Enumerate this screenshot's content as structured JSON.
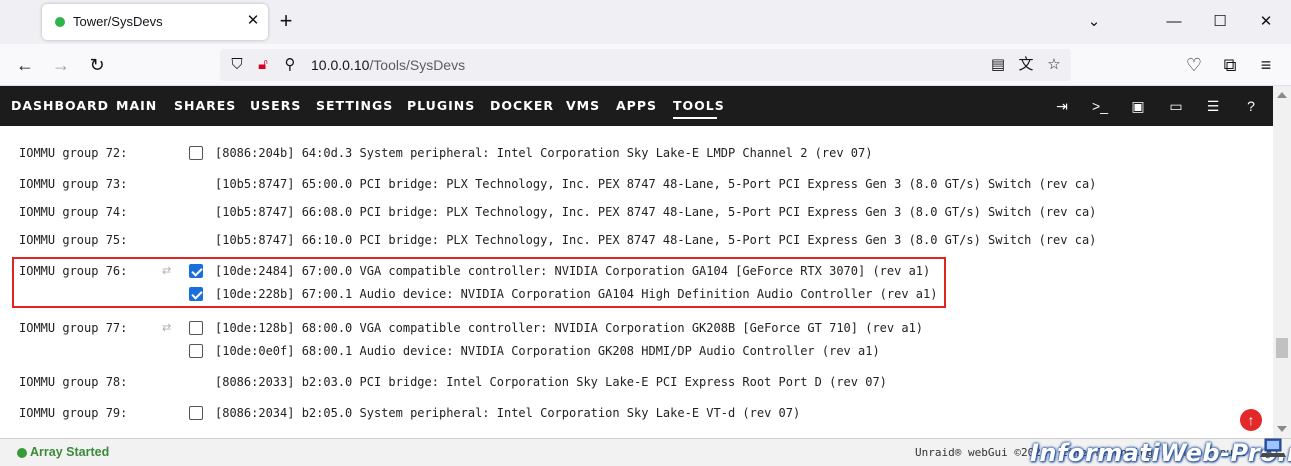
{
  "browser": {
    "tab_title": "Tower/SysDevs",
    "tab_status_color": "#2fb34a",
    "url_host": "10.0.0.10",
    "url_path": "/Tools/SysDevs"
  },
  "menu": {
    "items": [
      "DASHBOARD",
      "MAIN",
      "SHARES",
      "USERS",
      "SETTINGS",
      "PLUGINS",
      "DOCKER",
      "VMS",
      "APPS",
      "TOOLS"
    ],
    "active": "TOOLS",
    "icons": [
      "logout-icon",
      "terminal-icon",
      "feedback-icon",
      "monitor-icon",
      "log-icon",
      "help-icon"
    ]
  },
  "iommu": {
    "g72": {
      "label": "IOMMU group 72:",
      "devices": [
        {
          "text": "[8086:204b] 64:0d.3 System peripheral: Intel Corporation Sky Lake-E LMDP Channel 2 (rev 07)",
          "checked": false
        }
      ]
    },
    "g73": {
      "label": "IOMMU group 73:",
      "devices": [
        {
          "text": "[10b5:8747] 65:00.0 PCI bridge: PLX Technology, Inc. PEX 8747 48-Lane, 5-Port PCI Express Gen 3 (8.0 GT/s) Switch (rev ca)"
        }
      ]
    },
    "g74": {
      "label": "IOMMU group 74:",
      "devices": [
        {
          "text": "[10b5:8747] 66:08.0 PCI bridge: PLX Technology, Inc. PEX 8747 48-Lane, 5-Port PCI Express Gen 3 (8.0 GT/s) Switch (rev ca)"
        }
      ]
    },
    "g75": {
      "label": "IOMMU group 75:",
      "devices": [
        {
          "text": "[10b5:8747] 66:10.0 PCI bridge: PLX Technology, Inc. PEX 8747 48-Lane, 5-Port PCI Express Gen 3 (8.0 GT/s) Switch (rev ca)"
        }
      ]
    },
    "g76": {
      "label": "IOMMU group 76:",
      "devices": [
        {
          "text": "[10de:2484] 67:00.0 VGA compatible controller: NVIDIA Corporation GA104 [GeForce RTX 3070] (rev a1)",
          "checked": true
        },
        {
          "text": "[10de:228b] 67:00.1 Audio device: NVIDIA Corporation GA104 High Definition Audio Controller (rev a1)",
          "checked": true
        }
      ]
    },
    "g77": {
      "label": "IOMMU group 77:",
      "devices": [
        {
          "text": "[10de:128b] 68:00.0 VGA compatible controller: NVIDIA Corporation GK208B [GeForce GT 710] (rev a1)",
          "checked": false
        },
        {
          "text": "[10de:0e0f] 68:00.1 Audio device: NVIDIA Corporation GK208 HDMI/DP Audio Controller (rev a1)",
          "checked": false
        }
      ]
    },
    "g78": {
      "label": "IOMMU group 78:",
      "devices": [
        {
          "text": "[8086:2033] b2:03.0 PCI bridge: Intel Corporation Sky Lake-E PCI Express Root Port D (rev 07)"
        }
      ]
    },
    "g79": {
      "label": "IOMMU group 79:",
      "devices": [
        {
          "text": "[8086:2034] b2:05.0 System peripheral: Intel Corporation Sky Lake-E VT-d (rev 07)",
          "checked": false
        }
      ]
    }
  },
  "footer": {
    "status": "Array Started",
    "status_color": "#3a8a3a",
    "right_text": "Unraid® webGui ©2021, Lime Technology, Inc. manual",
    "watermark": "InformatiWeb-Pro.net"
  }
}
